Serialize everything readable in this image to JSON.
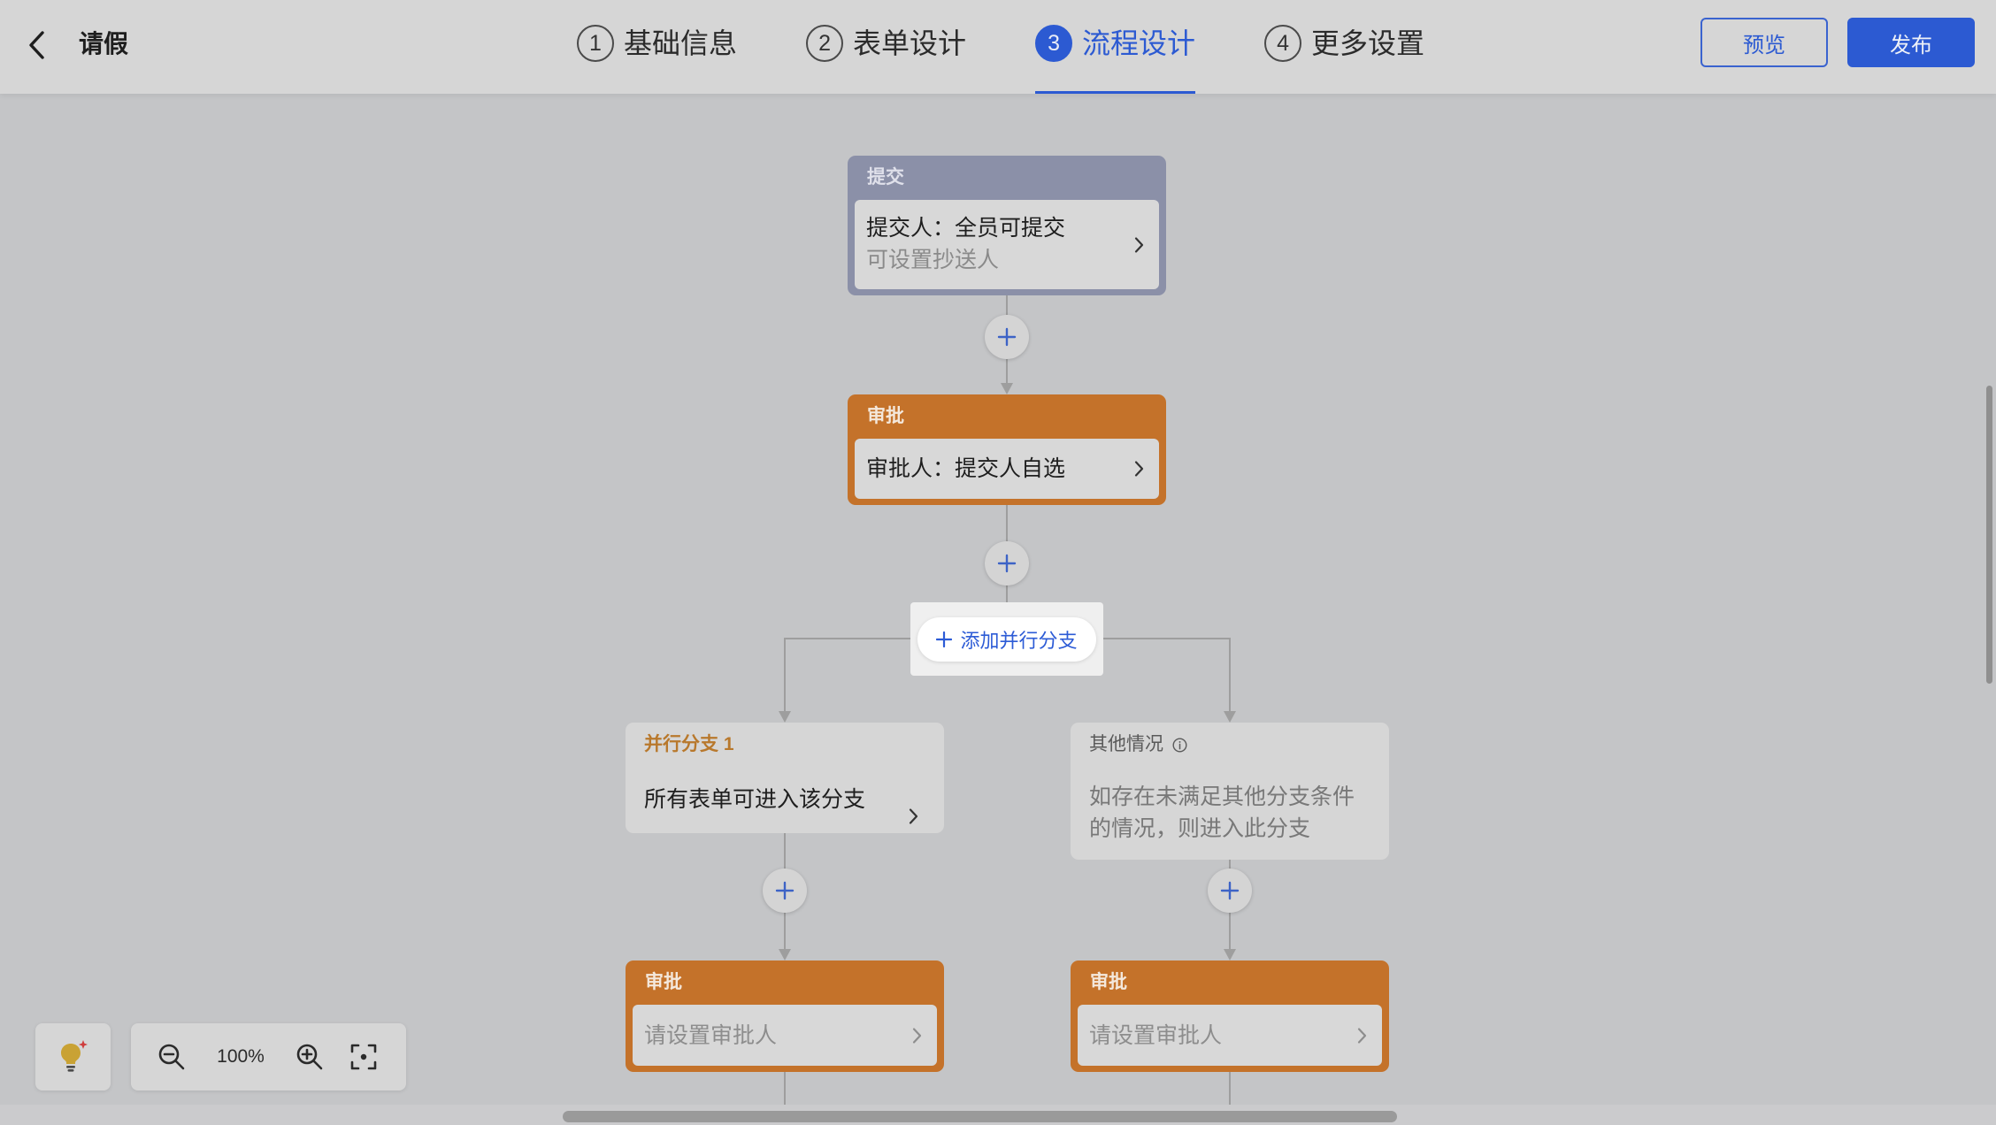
{
  "header": {
    "title": "请假",
    "steps": [
      {
        "number": "1",
        "label": "基础信息",
        "active": false
      },
      {
        "number": "2",
        "label": "表单设计",
        "active": false
      },
      {
        "number": "3",
        "label": "流程设计",
        "active": true
      },
      {
        "number": "4",
        "label": "更多设置",
        "active": false
      }
    ],
    "preview_label": "预览",
    "publish_label": "发布"
  },
  "flow": {
    "submit_node": {
      "header": "提交",
      "submitter": "提交人：全员可提交",
      "cc_hint": "可设置抄送人"
    },
    "approval_node": {
      "header": "审批",
      "approver": "审批人：提交人自选"
    },
    "add_parallel_branch_label": "添加并行分支",
    "branches": [
      {
        "title": "并行分支 1",
        "condition": "所有表单可进入该分支",
        "approval_node": {
          "header": "审批",
          "approver": "请设置审批人"
        }
      },
      {
        "title": "其他情况",
        "condition": "如存在未满足其他分支条件的情况，则进入此分支",
        "approval_node": {
          "header": "审批",
          "approver": "请设置审批人"
        }
      }
    ]
  },
  "zoom": {
    "level": "100%"
  },
  "icons": {
    "back": "chevron-left-icon",
    "node_detail": "chevron-right-icon",
    "add_node": "plus-icon",
    "add_branch": "plus-icon",
    "branch_info": "info-icon",
    "assistant": "lightbulb-icon",
    "zoom_out": "zoom-out-icon",
    "zoom_in": "zoom-in-icon",
    "fit_view": "fit-view-icon"
  },
  "colors": {
    "primary": "#2c5ad2",
    "approval-header": "#c4722a",
    "submit-header": "#8b90a8",
    "branch-title": "#b8782c",
    "canvas": "#c4c5c7",
    "surface": "#d6d6d6"
  }
}
